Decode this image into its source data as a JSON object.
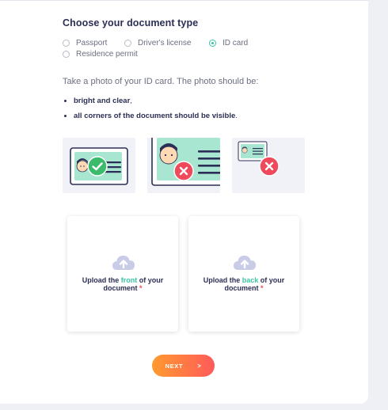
{
  "form": {
    "title": "Choose your document type",
    "doc_types": [
      {
        "label": "Passport",
        "checked": false
      },
      {
        "label": "Driver's license",
        "checked": false
      },
      {
        "label": "ID card",
        "checked": true
      },
      {
        "label": "Residence permit",
        "checked": false
      }
    ]
  },
  "instructions": {
    "intro": "Take a photo of your ID card. The photo should be:",
    "bullets": [
      {
        "text": "bright and clear",
        "punct": ","
      },
      {
        "text": "all corners of the document should be visible",
        "punct": "."
      }
    ]
  },
  "examples": [
    {
      "status": "correct",
      "icon": "check-icon"
    },
    {
      "status": "incorrect",
      "icon": "cross-icon"
    },
    {
      "status": "incorrect",
      "icon": "cross-icon"
    }
  ],
  "uploads": {
    "front": {
      "prefix": "Upload the",
      "highlight": "front",
      "suffix": "of your",
      "line2": "document",
      "required": "*",
      "icon": "cloud-upload-icon"
    },
    "back": {
      "prefix": "Upload the",
      "highlight": "back",
      "suffix": "of your",
      "line2": "document",
      "required": "*",
      "icon": "cloud-upload-icon"
    }
  },
  "next_button": {
    "label": "NEXT",
    "arrow": ">"
  },
  "colors": {
    "accent": "#3cc3a6",
    "text_dark": "#2b2f55",
    "error": "#f0495c",
    "button_start": "#ff9a2e",
    "button_end": "#ff5a5a"
  }
}
